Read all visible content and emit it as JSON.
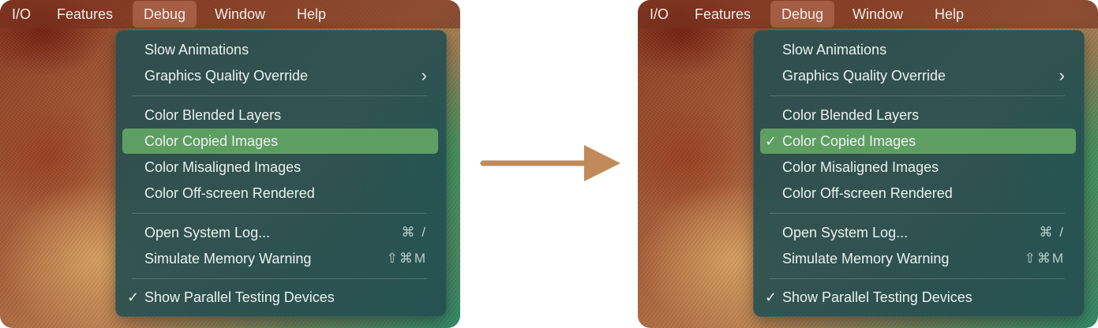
{
  "menubar": {
    "items": [
      "I/O",
      "Features",
      "Debug",
      "Window",
      "Help"
    ]
  },
  "menu": {
    "slow_animations": "Slow Animations",
    "graphics_quality_override": "Graphics Quality Override",
    "color_blended_layers": "Color Blended Layers",
    "color_copied_images": "Color Copied Images",
    "color_misaligned_images": "Color Misaligned Images",
    "color_offscreen_rendered": "Color Off-screen Rendered",
    "open_system_log": "Open System Log...",
    "open_system_log_shortcut": "⌘ /",
    "simulate_memory_warning": "Simulate Memory Warning",
    "simulate_memory_warning_shortcut": "⇧⌘M",
    "show_parallel_testing_devices": "Show Parallel Testing Devices",
    "checkmark": "✓",
    "submenu_chevron": "›"
  },
  "colors": {
    "menu_background": "#244e50",
    "highlight": "#5f9e63",
    "arrow": "#c08a5a"
  },
  "icons": {
    "transition_arrow": "right-arrow-icon"
  }
}
